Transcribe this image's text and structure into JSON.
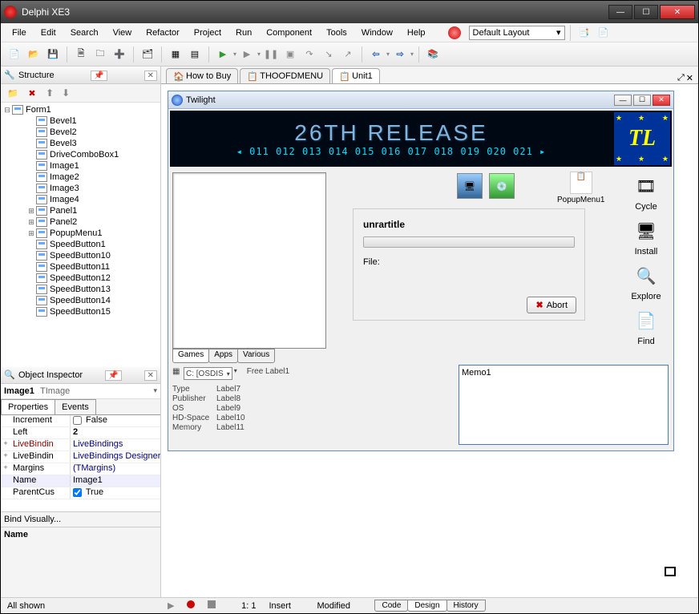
{
  "app": {
    "title": "Delphi XE3"
  },
  "menu": [
    "File",
    "Edit",
    "Search",
    "View",
    "Refactor",
    "Project",
    "Run",
    "Component",
    "Tools",
    "Window",
    "Help"
  ],
  "layout_combo": "Default Layout",
  "structure": {
    "title": "Structure",
    "root": "Form1",
    "items": [
      "Bevel1",
      "Bevel2",
      "Bevel3",
      "DriveComboBox1",
      "Image1",
      "Image2",
      "Image3",
      "Image4",
      "Panel1",
      "Panel2",
      "PopupMenu1",
      "SpeedButton1",
      "SpeedButton10",
      "SpeedButton11",
      "SpeedButton12",
      "SpeedButton13",
      "SpeedButton14",
      "SpeedButton15"
    ]
  },
  "oi": {
    "title": "Object Inspector",
    "selected": "Image1",
    "classname": "TImage",
    "tabs": [
      "Properties",
      "Events"
    ],
    "rows": [
      {
        "k": "Increment",
        "v": "False",
        "exp": "",
        "chk": true
      },
      {
        "k": "Left",
        "v": "2",
        "bold": true
      },
      {
        "k": "LiveBindin",
        "v": "LiveBindings",
        "kred": true,
        "vblue": true,
        "exp": "+"
      },
      {
        "k": "LiveBindin",
        "v": "LiveBindings Designer",
        "vblue": true,
        "exp": "+"
      },
      {
        "k": "Margins",
        "v": "(TMargins)",
        "vblue": true,
        "exp": "+"
      },
      {
        "k": "Name",
        "v": "Image1",
        "sel": true
      },
      {
        "k": "ParentCus",
        "v": "True",
        "chk": true
      }
    ],
    "bindlink": "Bind Visually...",
    "name_lbl": "Name"
  },
  "doctabs": [
    {
      "label": "How to Buy",
      "icon": "home"
    },
    {
      "label": "THOOFDMENU",
      "icon": "form"
    },
    {
      "label": "Unit1",
      "icon": "form",
      "active": true
    }
  ],
  "form": {
    "title": "Twilight",
    "banner_text": "26TH RELEASE",
    "banner_nums": "◂  011   012   013   014   015   016   017   018   019   020   021  ▸",
    "logo": "TL",
    "lttabs": [
      "Games",
      "Apps",
      "Various"
    ],
    "combo": "C: [OSDIS",
    "freelabel": "Free Label1",
    "info": [
      {
        "k": "Type",
        "v": "Label7"
      },
      {
        "k": "Publisher",
        "v": "Label8"
      },
      {
        "k": "OS",
        "v": "Label9"
      },
      {
        "k": "HD-Space",
        "v": "Label10"
      },
      {
        "k": "Memory",
        "v": "Label11"
      }
    ],
    "unrar_title": "unrartitle",
    "file_lbl": "File:",
    "abort": "Abort",
    "popup": "PopupMenu1",
    "sidebtns": [
      "Cycle",
      "Install",
      "Explore",
      "Find"
    ],
    "memo": "Memo1"
  },
  "status": {
    "left": "All shown",
    "pos": "1: 1",
    "mode": "Insert",
    "modified": "Modified",
    "tabs": [
      "Code",
      "Design",
      "History"
    ]
  }
}
